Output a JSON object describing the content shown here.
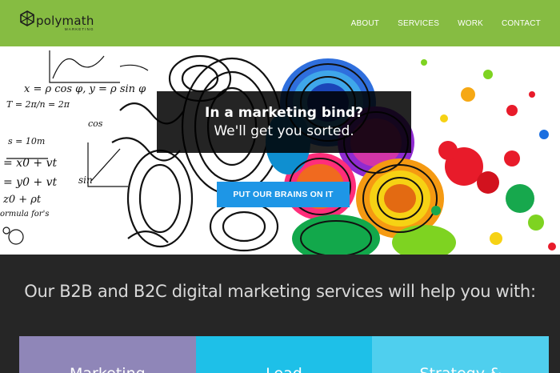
{
  "header": {
    "logo_name": "polymath",
    "logo_sub": "MARKETING",
    "nav": [
      {
        "label": "ABOUT"
      },
      {
        "label": "SERVICES"
      },
      {
        "label": "WORK"
      },
      {
        "label": "CONTACT"
      }
    ],
    "colors": {
      "background": "#86bc42",
      "text": "#ffffff"
    }
  },
  "hero": {
    "title": "In a marketing bind?",
    "subtitle": "We'll get you sorted.",
    "cta_label": "PUT OUR BRAINS ON IT",
    "math_scribbles": [
      "x = ρ cos φ, y = ρ sin φ",
      "T = 2π/n = 2π",
      "s = 10m",
      "= x0 + vt",
      "= y0 + vt",
      "z0 + ρt",
      "ormula for's",
      "sin",
      "cos"
    ],
    "colors": {
      "overlay": "#000000",
      "cta": "#1e96e6"
    }
  },
  "services": {
    "heading": "Our B2B and B2C digital marketing services will help you with:",
    "cards": [
      {
        "label": "Marketing",
        "color": "#8f86b8"
      },
      {
        "label": "Lead",
        "color": "#1ec0e8"
      },
      {
        "label": "Strategy &",
        "color": "#4fcfee"
      }
    ],
    "colors": {
      "background": "#262626",
      "heading": "#d9d9d9"
    }
  }
}
